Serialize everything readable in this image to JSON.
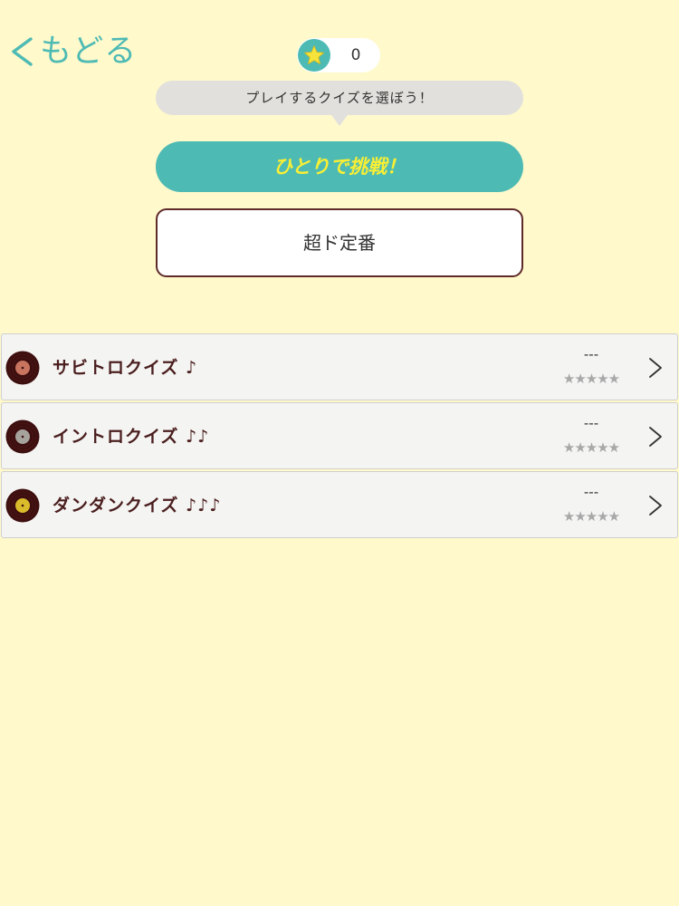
{
  "header": {
    "back_label": "もどる",
    "coin_count": "0"
  },
  "prompt": {
    "text": "プレイするクイズを選ぼう！"
  },
  "solo_button": {
    "label": "ひとりで挑戦！"
  },
  "category_button": {
    "label": "超ド定番"
  },
  "quiz_list": [
    {
      "title": "サビトロクイズ ♪",
      "score": "---",
      "stars": "★★★★★",
      "disc_color": "#c8745f"
    },
    {
      "title": "イントロクイズ ♪♪",
      "score": "---",
      "stars": "★★★★★",
      "disc_color": "#a6a39d"
    },
    {
      "title": "ダンダンクイズ ♪♪♪",
      "score": "---",
      "stars": "★★★★★",
      "disc_color": "#d9bb2c"
    }
  ],
  "colors": {
    "background": "#fff9cb",
    "accent_teal": "#4dbab4",
    "solo_text_yellow": "#f8ef35",
    "category_border": "#5e2a2a",
    "disc_outer": "#3d0f0f",
    "star_gray": "#a8a8a8"
  },
  "icons": {
    "back": "chevron-left-icon",
    "coin": "star-icon",
    "disc": "record-disc-icon",
    "row_next": "chevron-right-icon"
  }
}
